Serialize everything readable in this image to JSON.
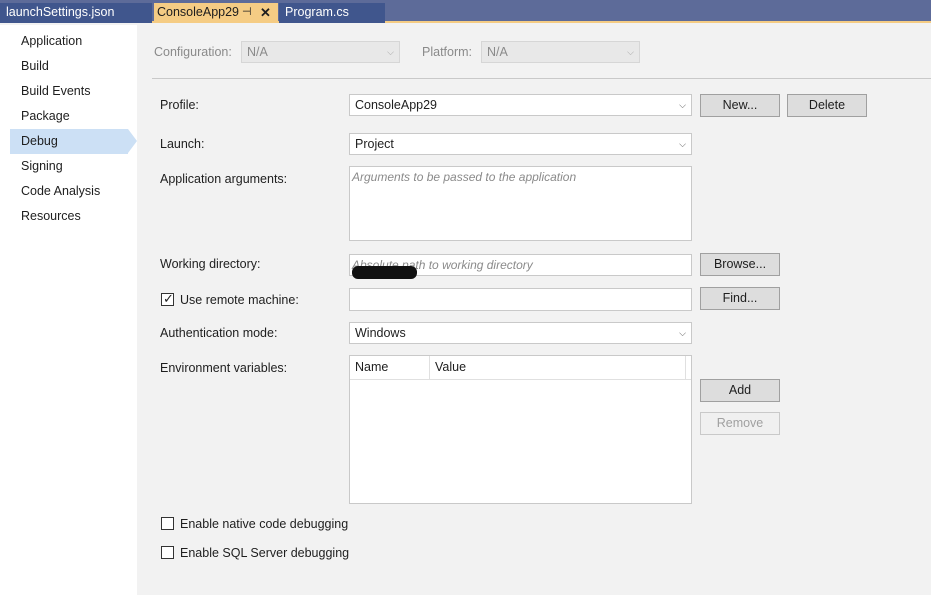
{
  "tabs": [
    {
      "label": "launchSettings.json"
    },
    {
      "label": "ConsoleApp29",
      "pin": "⊣",
      "close": "✕"
    },
    {
      "label": "Program.cs"
    }
  ],
  "sidebar": {
    "items": [
      {
        "label": "Application"
      },
      {
        "label": "Build"
      },
      {
        "label": "Build Events"
      },
      {
        "label": "Package"
      },
      {
        "label": "Debug",
        "active": true
      },
      {
        "label": "Signing"
      },
      {
        "label": "Code Analysis"
      },
      {
        "label": "Resources"
      }
    ]
  },
  "config": {
    "configuration_label": "Configuration:",
    "configuration_value": "N/A",
    "platform_label": "Platform:",
    "platform_value": "N/A"
  },
  "debug": {
    "profile_label": "Profile:",
    "profile_value": "ConsoleApp29",
    "new_button": "New...",
    "delete_button": "Delete",
    "launch_label": "Launch:",
    "launch_value": "Project",
    "app_args_label": "Application arguments:",
    "app_args_placeholder": "Arguments to be passed to the application",
    "working_dir_label": "Working directory:",
    "working_dir_placeholder": "Absolute path to working directory",
    "browse_button": "Browse...",
    "remote_label": "Use remote machine:",
    "remote_checked": true,
    "find_button": "Find...",
    "auth_label": "Authentication mode:",
    "auth_value": "Windows",
    "env_label": "Environment variables:",
    "env_columns": [
      "Name",
      "Value"
    ],
    "add_button": "Add",
    "remove_button": "Remove",
    "native_label": "Enable native code debugging",
    "native_checked": false,
    "sql_label": "Enable SQL Server debugging",
    "sql_checked": false
  },
  "icons": {
    "dropdown_arrow": "chevron-down-icon",
    "check": "checkmark-icon"
  },
  "colors": {
    "tabstrip": "#5d6b99",
    "active_tab": "#f5cc84",
    "sidebar_selection": "#cce0f5"
  }
}
